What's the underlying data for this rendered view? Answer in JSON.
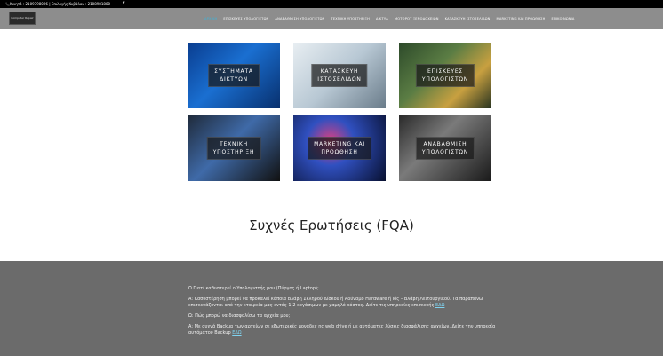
{
  "topbar": {
    "contact": "📞Κινητό : 2109798096 | Επιλογής Κυβάλου : 2108981880",
    "facebook": "f"
  },
  "logo": {
    "text": "Computer Repair"
  },
  "nav": {
    "items": [
      {
        "label": "ΑΡΧΙΚΗ",
        "active": true
      },
      {
        "label": "ΕΠΙΣΚΕΥΕΣ ΥΠΟΛΟΓΙΣΤΩΝ"
      },
      {
        "label": "ΑΝΑΒΑΘΜΙΣΗ ΥΠΟΛΟΓΙΣΤΩΝ"
      },
      {
        "label": "ΤΕΧΝΙΚΗ ΥΠΟΣΤΗΡΙΞΗ"
      },
      {
        "label": "ΔΙΚΤΥΑ"
      },
      {
        "label": "ΜΟΤΟΡΟΤ ΞΕΝΟΔΟΧΕΙΩΝ"
      },
      {
        "label": "ΚΑΤΑΣΚΕΥΗ ΙΣΤΟΣΕΛΙΔΩΝ"
      },
      {
        "label": "MARKETING και ΠΡΟΩΘΗΣΗ"
      },
      {
        "label": "ΕΠΙΚΟΙΝΩΝΙΑ"
      }
    ]
  },
  "tiles": [
    {
      "line1": "ΣΥΣΤΗΜΑΤΑ",
      "line2": "ΔΙΚΤΥΩΝ"
    },
    {
      "line1": "ΚΑΤΑΣΚΕΥΗ",
      "line2": "ΙΣΤΟΣΕΛΙΔΩΝ"
    },
    {
      "line1": "ΕΠΙΣΚΕΥΕΣ",
      "line2": "ΥΠΟΛΟΓΙΣΤΩΝ"
    },
    {
      "line1": "ΤΕΧΝΙΚΗ",
      "line2": "ΥΠΟΣΤΗΡΙΞΗ"
    },
    {
      "line1": "MARKETING ΚΑΙ",
      "line2": "ΠΡΟΩΘΗΣΗ"
    },
    {
      "line1": "ΑΝΑΒΑΘΜΙΣΗ",
      "line2": "ΥΠΟΛΟΓΙΣΤΩΝ"
    }
  ],
  "faq": {
    "title": "Συχνές Ερωτήσεις (FQA)",
    "q1": "Ω Γιατί καθυστερεί ο Υπολογιστής μου (Πύργος ή Laptop);",
    "a1": "Α: Καθυστέρηση μπορεί να προκαλεί κάποια Βλάβη Σκληρού Δίσκου ή Αδύναμο Hardware ή Ιός – Βλάβη Λειτουργικού. Τα παραπάνω επισκευάζονται από την εταιρεία μας εντός 1-2 εργάσιμων με χαμηλό κόστος. Δείτε τις υπηρεσίες επισκευής",
    "a1_link": "ΕΔΩ",
    "q2": "Ω: Πώς μπορώ να διασφαλίσω τα αρχεία μου;",
    "a2": "Α: Με συχνά Backup των αρχείων σε εξωτερικές μονάδες ης web drive ή με αυτόματες λύσεις διασφάλισης αρχείων. Δείτε την υπηρεσία αυτόματου Backup",
    "a2_link": "ΕΔΩ"
  }
}
